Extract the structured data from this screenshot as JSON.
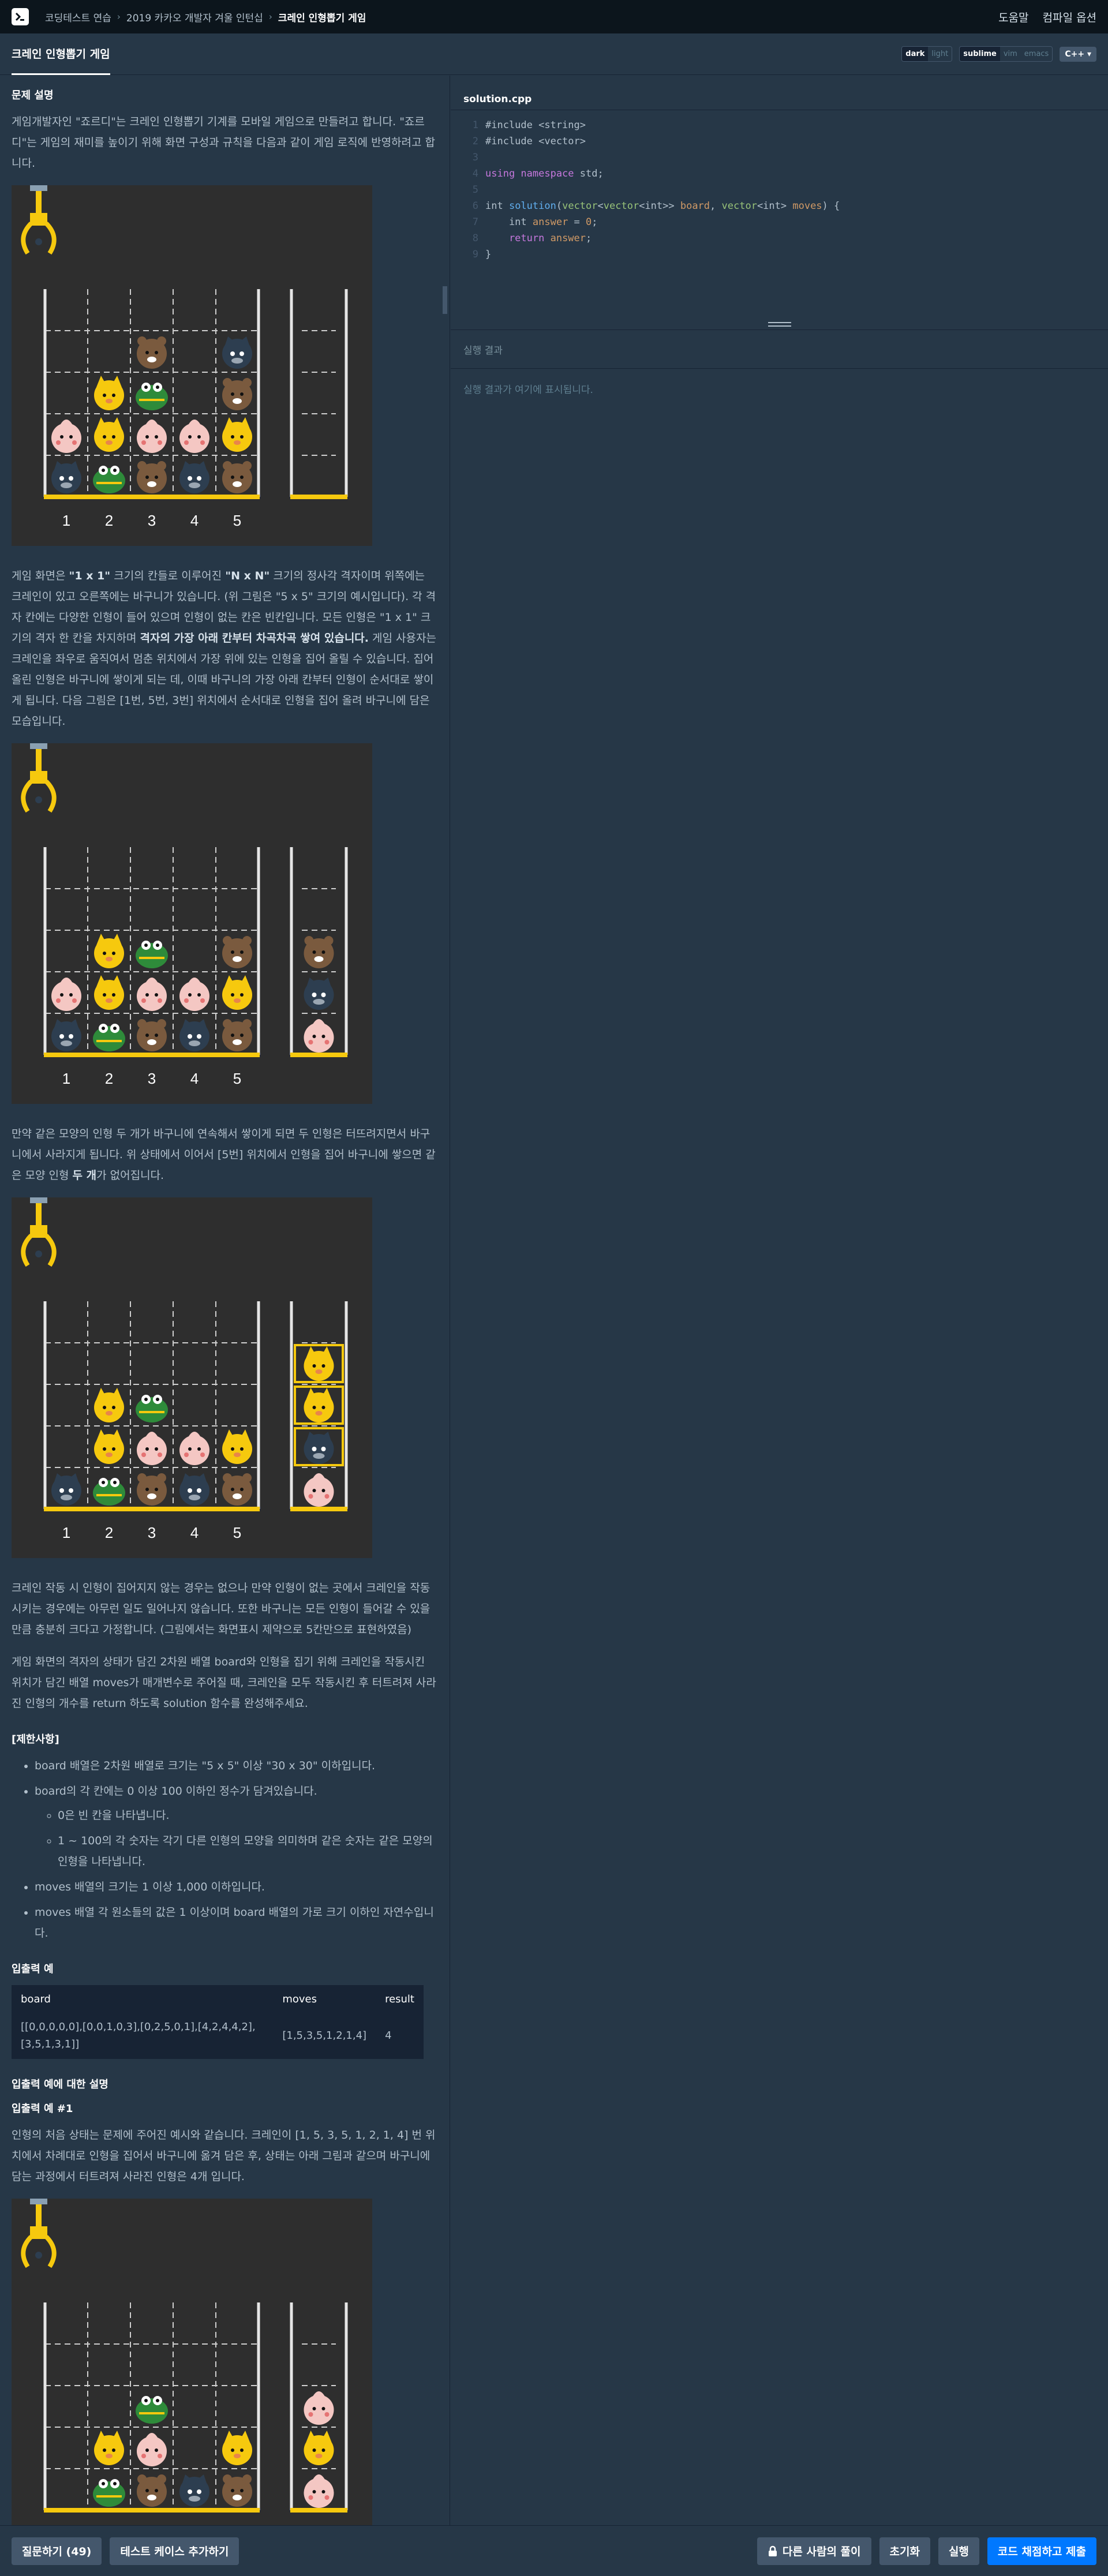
{
  "nav": {
    "crumbs": [
      "코딩테스트 연습",
      "2019 카카오 개발자 겨울 인턴십",
      "크레인 인형뽑기 게임"
    ],
    "help": "도움말",
    "compile_options": "컴파일 옵션"
  },
  "tab": {
    "title": "크레인 인형뽑기 게임"
  },
  "theme": {
    "options": [
      "dark",
      "light"
    ],
    "selected": "dark"
  },
  "keymap": {
    "options": [
      "sublime",
      "vim",
      "emacs"
    ],
    "selected": "sublime"
  },
  "language": "C++",
  "guide": {
    "section_title": "문제 설명",
    "p1": "게임개발자인 \"죠르디\"는 크레인 인형뽑기 기계를 모바일 게임으로 만들려고 합니다. \"죠르디\"는 게임의 재미를 높이기 위해 화면 구성과 규칙을 다음과 같이 게임 로직에 반영하려고 합니다.",
    "p2a": "게임 화면은 ",
    "p2b": "\"1 x 1\"",
    "p2c": " 크기의 칸들로 이루어진 ",
    "p2d": "\"N x N\"",
    "p2e": " 크기의 정사각 격자이며 위쪽에는 크레인이 있고 오른쪽에는 바구니가 있습니다. (위 그림은 \"5 x 5\" 크기의 예시입니다). 각 격자 칸에는 다양한 인형이 들어 있으며 인형이 없는 칸은 빈칸입니다. 모든 인형은 \"1 x 1\" 크기의 격자 한 칸을 차지하며 ",
    "p2f": "격자의 가장 아래 칸부터 차곡차곡 쌓여 있습니다.",
    "p2g": " 게임 사용자는 크레인을 좌우로 움직여서 멈춘 위치에서 가장 위에 있는 인형을 집어 올릴 수 있습니다. 집어 올린 인형은 바구니에 쌓이게 되는 데, 이때 바구니의 가장 아래 칸부터 인형이 순서대로 쌓이게 됩니다. 다음 그림은 [1번, 5번, 3번] 위치에서 순서대로 인형을 집어 올려 바구니에 담은 모습입니다.",
    "p3a": "만약 같은 모양의 인형 두 개가 바구니에 연속해서 쌓이게 되면 두 인형은 터뜨려지면서 바구니에서 사라지게 됩니다. 위 상태에서 이어서 [5번] 위치에서 인형을 집어 바구니에 쌓으면 같은 모양 인형 ",
    "p3b": "두 개",
    "p3c": "가 없어집니다.",
    "p4": "크레인 작동 시 인형이 집어지지 않는 경우는 없으나 만약 인형이 없는 곳에서 크레인을 작동시키는 경우에는 아무런 일도 일어나지 않습니다. 또한 바구니는 모든 인형이 들어갈 수 있을 만큼 충분히 크다고 가정합니다. (그림에서는 화면표시 제약으로 5칸만으로 표현하였음)",
    "p5": "게임 화면의 격자의 상태가 담긴 2차원 배열 board와 인형을 집기 위해 크레인을 작동시킨 위치가 담긴 배열 moves가 매개변수로 주어질 때, 크레인을 모두 작동시킨 후 터트려져 사라진 인형의 개수를 return 하도록 solution 함수를 완성해주세요.",
    "constraints_title": "[제한사항]",
    "c1": "board 배열은 2차원 배열로 크기는 \"5 x 5\" 이상 \"30 x 30\" 이하입니다.",
    "c2": "board의 각 칸에는 0 이상 100 이하인 정수가 담겨있습니다.",
    "c2a": "0은 빈 칸을 나타냅니다.",
    "c2b": "1 ~ 100의 각 숫자는 각기 다른 인형의 모양을 의미하며 같은 숫자는 같은 모양의 인형을 나타냅니다.",
    "c3": "moves 배열의 크기는 1 이상 1,000 이하입니다.",
    "c4": "moves 배열 각 원소들의 값은 1 이상이며 board 배열의 가로 크기 이하인 자연수입니다.",
    "io_title": "입출력 예",
    "io_headers": [
      "board",
      "moves",
      "result"
    ],
    "io_row": [
      "[[0,0,0,0,0],[0,0,1,0,3],[0,2,5,0,1],[4,2,4,4,2],[3,5,1,3,1]]",
      "[1,5,3,5,1,2,1,4]",
      "4"
    ],
    "io_desc_title": "입출력 예에 대한 설명",
    "io_ex1_title": "입출력 예 #1",
    "io_ex1": "인형의 처음 상태는 문제에 주어진 예시와 같습니다. 크레인이 [1, 5, 3, 5, 1, 2, 1, 4] 번 위치에서 차례대로 인형을 집어서 바구니에 옮겨 담은 후, 상태는 아래 그림과 같으며 바구니에 담는 과정에서 터트려져 사라진 인형은 4개 입니다.",
    "column_numbers": [
      "1",
      "2",
      "3",
      "4",
      "5"
    ]
  },
  "figures": [
    {
      "grid": [
        [
          0,
          0,
          0,
          0,
          0
        ],
        [
          0,
          0,
          1,
          0,
          3
        ],
        [
          0,
          2,
          5,
          0,
          1
        ],
        [
          4,
          2,
          4,
          4,
          2
        ],
        [
          3,
          5,
          1,
          3,
          1
        ]
      ],
      "basket": []
    },
    {
      "grid": [
        [
          0,
          0,
          0,
          0,
          0
        ],
        [
          0,
          0,
          0,
          0,
          0
        ],
        [
          0,
          2,
          5,
          0,
          1
        ],
        [
          4,
          2,
          4,
          4,
          2
        ],
        [
          3,
          5,
          1,
          3,
          1
        ]
      ],
      "basket": [
        4,
        3,
        1
      ]
    },
    {
      "grid": [
        [
          0,
          0,
          0,
          0,
          0
        ],
        [
          0,
          0,
          0,
          0,
          0
        ],
        [
          0,
          2,
          5,
          0,
          0
        ],
        [
          0,
          2,
          4,
          4,
          2
        ],
        [
          3,
          5,
          1,
          3,
          1
        ]
      ],
      "basket": [
        4,
        3,
        2,
        2
      ]
    },
    {
      "grid": [
        [
          0,
          0,
          0,
          0,
          0
        ],
        [
          0,
          0,
          0,
          0,
          0
        ],
        [
          0,
          0,
          5,
          0,
          0
        ],
        [
          0,
          2,
          4,
          0,
          2
        ],
        [
          0,
          5,
          1,
          3,
          1
        ]
      ],
      "basket": [
        4,
        2,
        4
      ]
    }
  ],
  "editor": {
    "filename": "solution.cpp",
    "line_numbers": [
      "1",
      "2",
      "3",
      "4",
      "5",
      "6",
      "7",
      "8",
      "9"
    ],
    "l1": "#include <string>",
    "l2": "#include <vector>",
    "l4_kw": "using namespace",
    "l4_rest": " std;",
    "l6_a": "int ",
    "l6_fn": "solution",
    "l6_b": "(",
    "l6_t1": "vector",
    "l6_c": "<",
    "l6_t2": "vector",
    "l6_d": "<int>> ",
    "l6_p1": "board",
    "l6_e": ", ",
    "l6_t3": "vector",
    "l6_f": "<int> ",
    "l6_p2": "moves",
    "l6_g": ") {",
    "l7_a": "    int ",
    "l7_v": "answer",
    "l7_b": " = ",
    "l7_n": "0",
    "l7_c": ";",
    "l8_a": "    return ",
    "l8_v": "answer",
    "l8_b": ";",
    "l9": "}"
  },
  "result": {
    "title": "실행 결과",
    "placeholder": "실행 결과가 여기에 표시됩니다."
  },
  "bottom": {
    "ask": "질문하기 (49)",
    "add_test": "테스트 케이스 추가하기",
    "others": "다른 사람의 풀이",
    "reset": "초기화",
    "run": "실행",
    "submit": "코드 채점하고 제출"
  }
}
